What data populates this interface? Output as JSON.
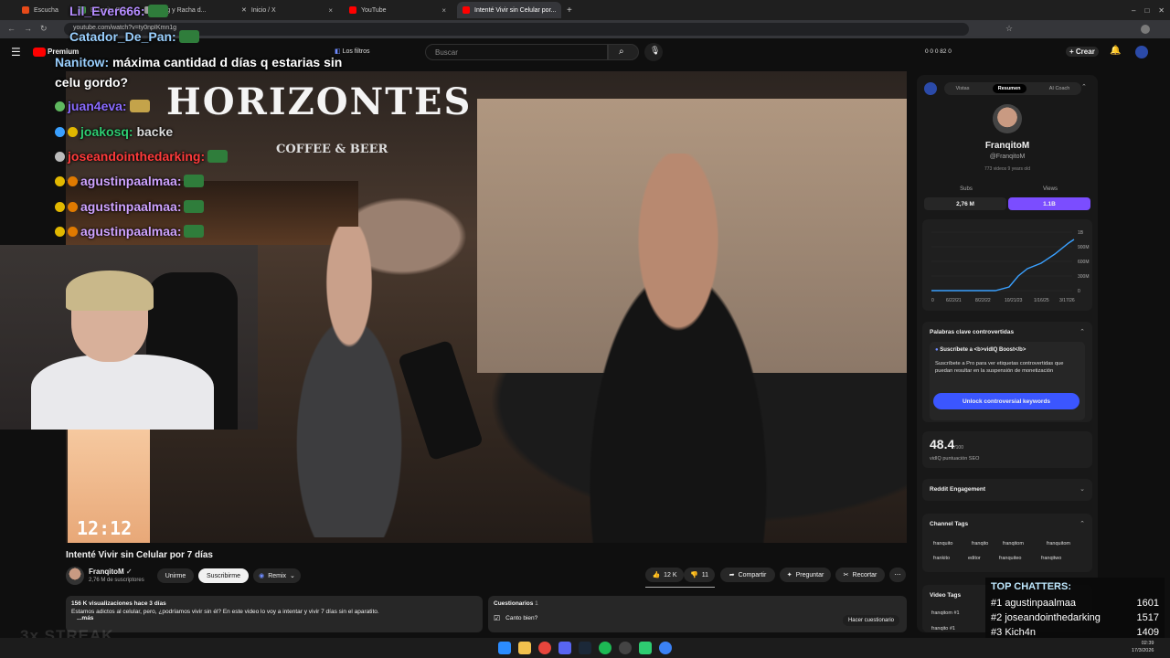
{
  "browser": {
    "tabs": [
      {
        "label": "Escucha",
        "color": "#e64a19"
      },
      {
        "label": "El Lorito Ruby...",
        "color": "#4caf50"
      },
      {
        "label": "...ing y Racha d...",
        "color": "#9e9e9e"
      },
      {
        "label": "Inicio / X",
        "color": "#ffffff"
      },
      {
        "label": "YouTube",
        "color": "#ff0000"
      },
      {
        "label": "Intenté Vivir sin Celular por...",
        "color": "#ff0000"
      }
    ],
    "url": "youtube.com/watch?v=ty0npIKmn1g"
  },
  "youtube": {
    "logo_text": "Premium",
    "filters_label": "Los filtros",
    "search_placeholder": "Buscar",
    "header_stats": "0  0  0  82  0",
    "create_label": "Crear"
  },
  "chat_overlay": [
    {
      "user": "Lil_Ever666:",
      "text": "",
      "color": "#b58cff"
    },
    {
      "user": "Catador_De_Pan:",
      "text": "",
      "color": "#9ad0ff"
    },
    {
      "user": "Nanitow:",
      "text": " máxima cantidad d días q estarias sin",
      "color": "#9ad0ff"
    },
    {
      "user": "",
      "text": "celu gordo?",
      "color": "#ffffff"
    },
    {
      "user": "juan4eva:",
      "text": "",
      "color": "#8a6bff"
    },
    {
      "user": "joakosq:",
      "text": " backe",
      "color": "#2ecc71"
    },
    {
      "user": "joseandointhedarking:",
      "text": "",
      "color": "#ff3b3b"
    },
    {
      "user": "agustinpaalmaa:",
      "text": "",
      "color": "#cfa3ff"
    },
    {
      "user": "agustinpaalmaa:",
      "text": "",
      "color": "#cfa3ff"
    },
    {
      "user": "agustinpaalmaa:",
      "text": "",
      "color": "#cfa3ff"
    }
  ],
  "video": {
    "sign_main": "HORIZONTES",
    "sign_sub": "COFFEE & BEER",
    "clock_text": "12:12",
    "title": "Intenté Vivir sin Celular por 7 días",
    "channel": "FranqitoM",
    "subs": "2,76 M de suscriptores",
    "join_label": "Unirme",
    "subscribe_label": "Suscribirme",
    "remix_label": "Remix",
    "likes": "12 K",
    "dislikes": "11",
    "share_label": "Compartir",
    "ask_label": "Preguntar",
    "clip_label": "Recortar",
    "views_line": "156 K visualizaciones  hace 3 días",
    "description": "Estamos adictos al celular, pero, ¿podríamos vivir sin él? En este video lo voy a intentar y vivir 7 días sin el aparatito.",
    "more_label": "...más",
    "quiz_title": "Cuestionarios",
    "quiz_count": "1",
    "quiz_item": "Canto bien?",
    "quiz_button": "Hacer cuestionario"
  },
  "vidiq": {
    "tabs": [
      "Vistas",
      "Resumen",
      "AI Coach"
    ],
    "active_tab": "Resumen",
    "name": "FranqitoM",
    "handle": "@FranqitoM",
    "meta": "773 videos    9 years old",
    "subs_label": "Subs",
    "views_label": "Views",
    "subs_value": "2,76 M",
    "views_value": "1.1B",
    "chart_yticks": [
      "1B",
      "900M",
      "600M",
      "300M",
      "0"
    ],
    "chart_xticks": [
      "0",
      "6/22/21",
      "8/22/22",
      "10/21/23",
      "1/16/25",
      "3/17/26"
    ],
    "keywords_title": "Palabras clave controvertidas",
    "boost_title": "Suscríbete a <b>vidIQ Boost</b>",
    "boost_text": "Suscríbete a Pro para ver etiquetas controvertidas que puedan resultar en la suspensión de monetización",
    "unlock_label": "Unlock controversial keywords",
    "seo_score": "48.4",
    "seo_of": "/100",
    "seo_label": "vidIQ puntuación SEO",
    "reddit_label": "Reddit Engagement",
    "channel_tags_label": "Channel Tags",
    "channel_tags": [
      "franquito",
      "franqito",
      "franqitom",
      "franquitom",
      "frankito",
      "editor",
      "franquiteo",
      "franqitwo"
    ],
    "video_tags_label": "Video Tags",
    "video_tags": [
      "franqitom #1",
      "franqito #1"
    ]
  },
  "top_chatters": {
    "title": "TOP CHATTERS:",
    "rows": [
      {
        "rank": "#1",
        "name": "agustinpaalmaa",
        "count": "1601"
      },
      {
        "rank": "#2",
        "name": "joseandointhedarking",
        "count": "1517"
      },
      {
        "rank": "#3",
        "name": "Kich4n",
        "count": "1409"
      }
    ]
  },
  "overlay_streak": "3x STREAK",
  "taskbar": {
    "lang": "ESP\nLAA",
    "time": "02:39",
    "date": "17/3/2026"
  }
}
